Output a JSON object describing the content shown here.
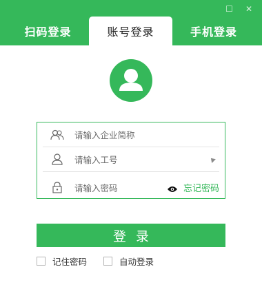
{
  "window": {
    "controls": [
      "☐",
      "✕"
    ]
  },
  "tabs": [
    {
      "label": "扫码登录"
    },
    {
      "label": "账号登录"
    },
    {
      "label": "手机登录"
    }
  ],
  "form": {
    "company_placeholder": "请输入企业简称",
    "id_placeholder": "请输入工号",
    "password_placeholder": "请输入密码",
    "forgot_password": "忘记密码"
  },
  "login": {
    "button_label": "登录"
  },
  "options": {
    "remember_password": "记住密码",
    "auto_login": "自动登录"
  },
  "colors": {
    "brand_green": "#35b85a",
    "divider": "#e3e3e3"
  },
  "icons": {
    "company": "group-icon",
    "id": "user-icon",
    "password": "lock-icon",
    "show_password": "eye-icon",
    "dropdown": "caret-icon",
    "avatar": "avatar-icon"
  }
}
